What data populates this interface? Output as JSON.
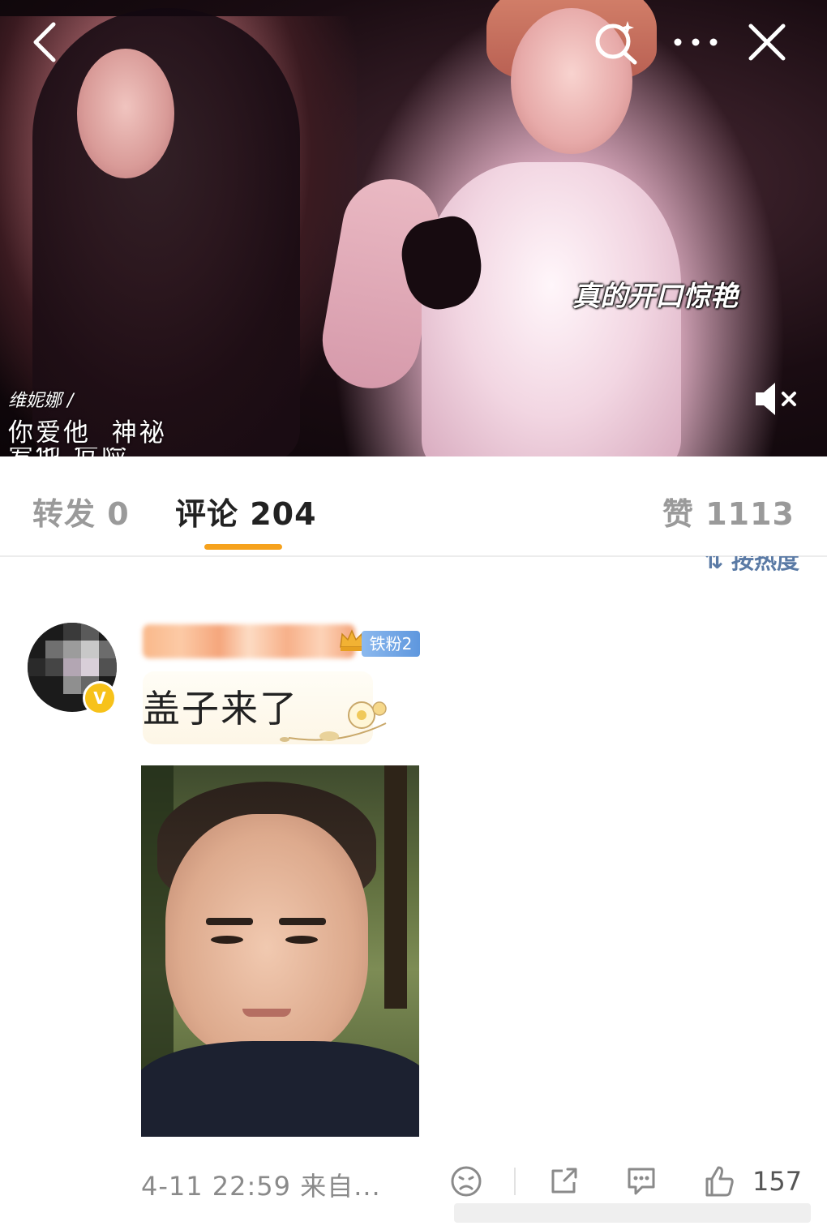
{
  "video": {
    "subtitle": "真的开口惊艳",
    "singer_label": "维妮娜 /",
    "lyric_line1": "你爱他  神祕",
    "lyric_line2": "爱他  危险",
    "muted": true
  },
  "top_bar": {
    "icons": [
      "back-icon",
      "search-spark-icon",
      "more-icon",
      "close-icon"
    ]
  },
  "tabs": [
    {
      "label": "转发 0",
      "active": false
    },
    {
      "label": "评论 204",
      "active": true
    },
    {
      "label": "赞 1113",
      "active": false
    }
  ],
  "sort_label": "按热度",
  "comment": {
    "fan_badge": "铁粉2",
    "text": "盖子来了",
    "meta": "4-11 22:59  来自...",
    "like_count": "157",
    "icons": [
      "dislike-face-icon",
      "share-icon",
      "reply-icon",
      "like-icon"
    ]
  },
  "colors": {
    "tab_indicator": "#f6a21d",
    "sort_text": "#5a7aa5",
    "fan_badge": "#6ea5e6",
    "verify_badge": "#f7c21a"
  }
}
